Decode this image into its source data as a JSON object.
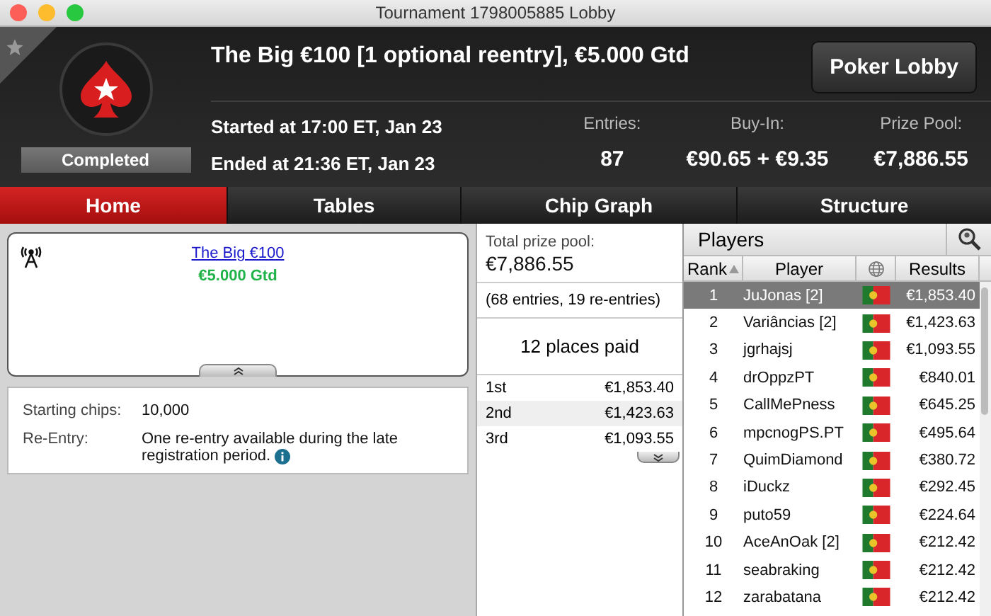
{
  "window": {
    "title": "Tournament 1798005885 Lobby"
  },
  "header": {
    "title": "The Big €100 [1 optional reentry], €5.000 Gtd",
    "status": "Completed",
    "started": "Started at 17:00 ET, Jan 23",
    "ended": "Ended at 21:36 ET, Jan 23",
    "lobby_button": "Poker Lobby",
    "stats": [
      {
        "label": "Entries:",
        "value": "87"
      },
      {
        "label": "Buy-In:",
        "value": "€90.65 + €9.35"
      },
      {
        "label": "Prize Pool:",
        "value": "€7,886.55"
      }
    ]
  },
  "tabs": [
    {
      "label": "Home",
      "selected": true
    },
    {
      "label": "Tables",
      "selected": false
    },
    {
      "label": "Chip Graph",
      "selected": false
    },
    {
      "label": "Structure",
      "selected": false
    }
  ],
  "info_card": {
    "link": "The Big €100",
    "guarantee": "€5.000 Gtd"
  },
  "details": [
    {
      "label": "Starting chips:",
      "value": "10,000",
      "info": false
    },
    {
      "label": "Re-Entry:",
      "value": "One re-entry available during the late registration period.",
      "info": true
    }
  ],
  "prize": {
    "total_label": "Total prize pool:",
    "total_value": "€7,886.55",
    "entries_note": "(68 entries, 19 re-entries)",
    "places_paid": "12 places paid",
    "payouts": [
      {
        "place": "1st",
        "amount": "€1,853.40"
      },
      {
        "place": "2nd",
        "amount": "€1,423.63"
      },
      {
        "place": "3rd",
        "amount": "€1,093.55"
      }
    ]
  },
  "players": {
    "title": "Players",
    "columns": [
      {
        "label": "Rank",
        "sorted": true
      },
      {
        "label": "Player",
        "sorted": false
      },
      {
        "label": "Results",
        "sorted": false
      }
    ],
    "rows": [
      {
        "rank": "1",
        "name": "JuJonas [2]",
        "results": "€1,853.40",
        "selected": true
      },
      {
        "rank": "2",
        "name": "Variâncias [2]",
        "results": "€1,423.63",
        "selected": false
      },
      {
        "rank": "3",
        "name": "jgrhajsj",
        "results": "€1,093.55",
        "selected": false
      },
      {
        "rank": "4",
        "name": "drOppzPT",
        "results": "€840.01",
        "selected": false
      },
      {
        "rank": "5",
        "name": "CallMePness",
        "results": "€645.25",
        "selected": false
      },
      {
        "rank": "6",
        "name": "mpcnogPS.PT",
        "results": "€495.64",
        "selected": false
      },
      {
        "rank": "7",
        "name": "QuimDiamond",
        "results": "€380.72",
        "selected": false
      },
      {
        "rank": "8",
        "name": "iDuckz",
        "results": "€292.45",
        "selected": false
      },
      {
        "rank": "9",
        "name": "puto59",
        "results": "€224.64",
        "selected": false
      },
      {
        "rank": "10",
        "name": "AceAnOak [2]",
        "results": "€212.42",
        "selected": false
      },
      {
        "rank": "11",
        "name": "seabraking",
        "results": "€212.42",
        "selected": false
      },
      {
        "rank": "12",
        "name": "zarabatana",
        "results": "€212.42",
        "selected": false
      }
    ]
  }
}
